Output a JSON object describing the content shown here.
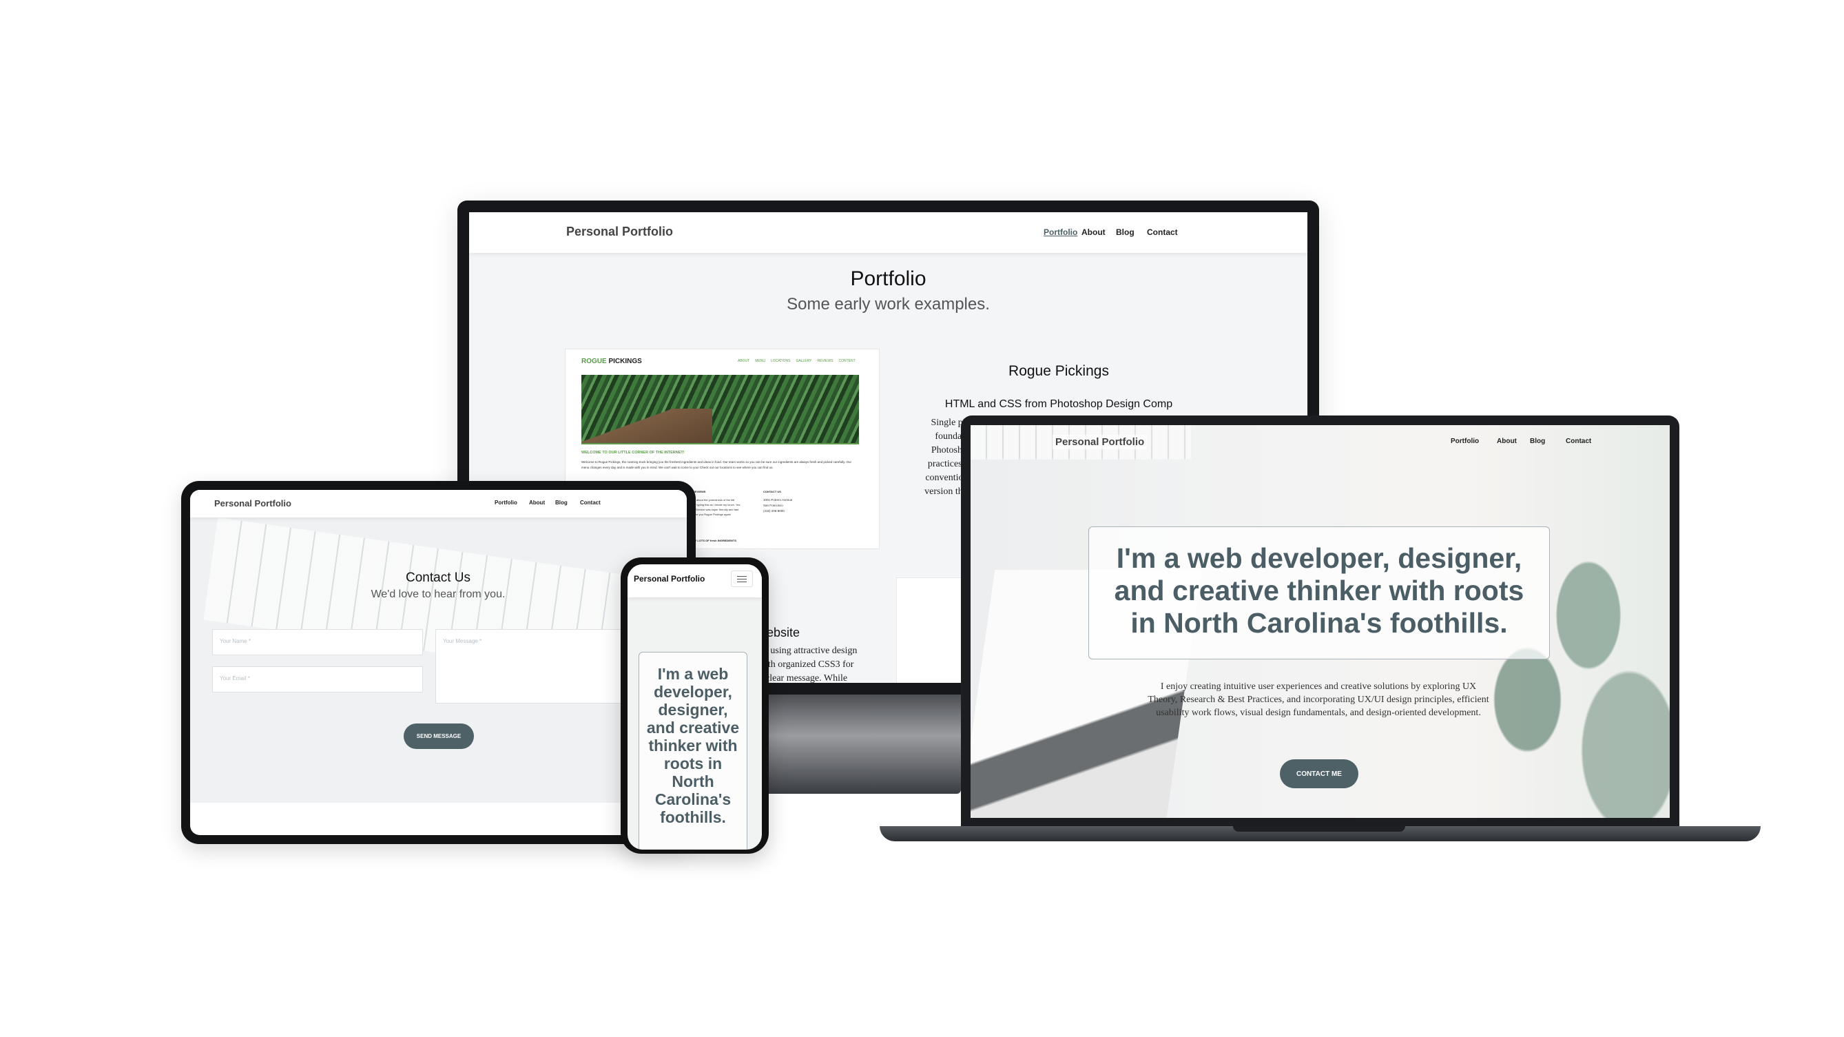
{
  "brand": "Personal Portfolio",
  "nav": [
    "Portfolio",
    "About",
    "Blog",
    "Contact"
  ],
  "colors": {
    "accent": "#4d6167",
    "rogue_green": "#5a9a4a"
  },
  "monitor": {
    "title": "Portfolio",
    "subtitle": "Some early work examples.",
    "project1": {
      "title": "Rogue Pickings",
      "subtitle": "HTML and CSS from Photoshop Design Comp",
      "desc_lines": [
        "Single pag",
        "foundatio",
        "Photoshop",
        "practices in",
        "conventions",
        "version then"
      ]
    },
    "project2": {
      "title_fragment": "ebsite",
      "desc_lines": [
        "t using attractive design",
        "ith organized CSS3 for",
        "clear message. While"
      ]
    },
    "rogue": {
      "logo_a": "ROGUE",
      "logo_b": "PICKINGS",
      "nav": [
        "ABOUT",
        "MENU",
        "LOCATIONS",
        "GALLERY",
        "REVIEWS",
        "CONTENT"
      ],
      "welcome": "WELCOME TO OUR LITTLE CORNER OF THE INTERNET!",
      "body": "Welcome to Rogue Pickings, the roaming truck bringing you the freshest ingredients and ideas in food. Our team works so you can be sure our ingredients are always fresh and picked carefully. Our menu changes every day and is made with you in mind. We can't wait to come to you! Check out our locations to see where you can find us.",
      "reviews_title": "AWESOME REVIEWS",
      "review": "\"I'm so excited about the yumminess of the fall salad that I am typing this as I inhale my lunch. Yes it is that good. Service was super friendly and fast. Can't wait to see you Rogue Pickings again tomorrow!\"",
      "contact_title": "CONTACT US",
      "address": [
        "1001 Potrero Avenue",
        "San Francisco",
        "(415) 206-8000"
      ],
      "footer": "POWERED BY LOTS OF fresh INGREDIENTS"
    }
  },
  "laptop": {
    "headline": "I'm a web developer, designer, and creative thinker with roots in North Carolina's foothills.",
    "intro": "I enjoy creating intuitive user experiences and creative solutions by exploring UX Theory, Research & Best Practices, and incorporating UX/UI design principles, efficient usability work flows, visual design fundamentals, and design-oriented development.",
    "cta": "CONTACT ME"
  },
  "tablet": {
    "title": "Contact Us",
    "subtitle": "We'd love to hear from you.",
    "name_placeholder": "Your Name *",
    "email_placeholder": "Your Email *",
    "message_placeholder": "Your Message *",
    "submit": "SEND MESSAGE"
  },
  "phone": {
    "menu_icon": "hamburger-icon",
    "headline": "I'm a web developer, designer, and creative thinker with roots in North Carolina's foothills."
  }
}
